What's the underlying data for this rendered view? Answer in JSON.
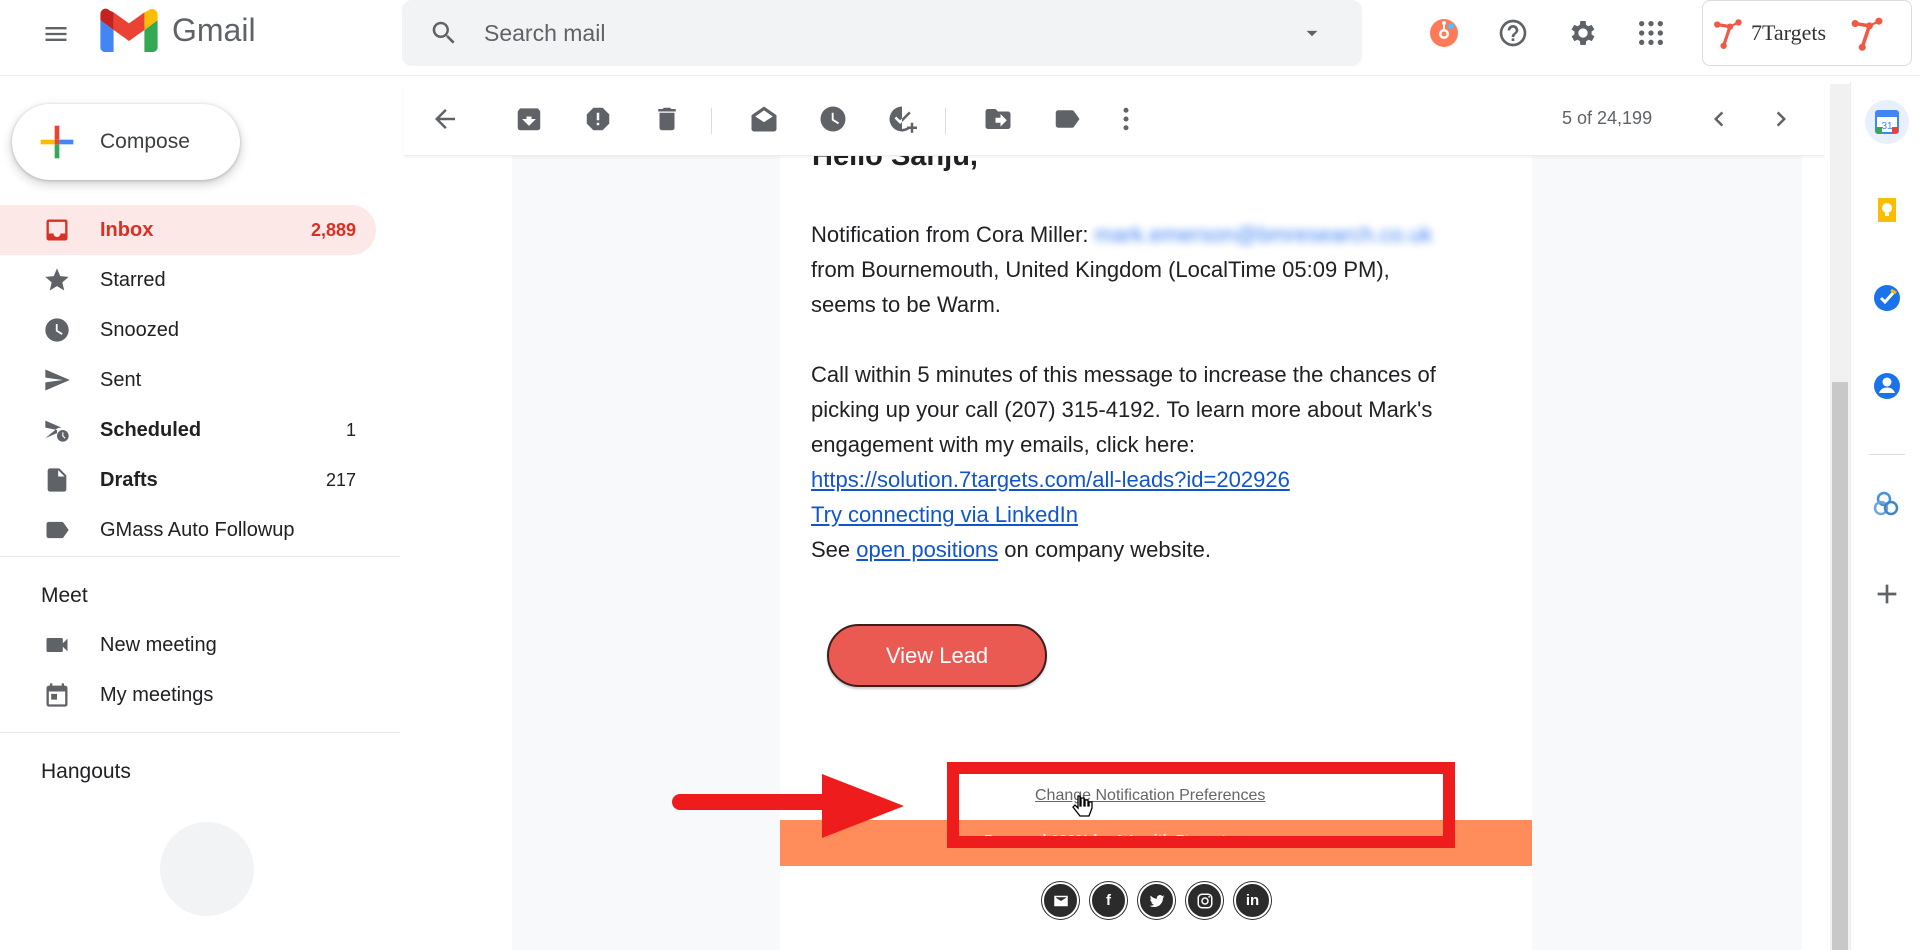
{
  "app": {
    "name": "Gmail"
  },
  "search": {
    "placeholder": "Search mail"
  },
  "header": {
    "brand_name": "7Targets"
  },
  "compose": {
    "label": "Compose"
  },
  "sidebar": {
    "items": [
      {
        "label": "Inbox",
        "count": "2,889"
      },
      {
        "label": "Starred",
        "count": ""
      },
      {
        "label": "Snoozed",
        "count": ""
      },
      {
        "label": "Sent",
        "count": ""
      },
      {
        "label": "Scheduled",
        "count": "1"
      },
      {
        "label": "Drafts",
        "count": "217"
      },
      {
        "label": "GMass Auto Followup",
        "count": ""
      }
    ],
    "meet_title": "Meet",
    "meet_items": [
      {
        "label": "New meeting"
      },
      {
        "label": "My meetings"
      }
    ],
    "hangouts_title": "Hangouts"
  },
  "toolbar": {
    "pager": "5 of 24,199"
  },
  "email": {
    "greeting": "Hello Sanju,",
    "line1_prefix": "Notification from Cora Miller:",
    "line1_email": "mark.emerson@bmresearch.co.uk",
    "line2": "from Bournemouth, United Kingdom (LocalTime 05:09 PM),",
    "line3": "seems to be Warm.",
    "para2_l1": "Call within 5 minutes of this message to increase the chances of",
    "para2_l2": "picking up your call (207) 315-4192. To learn more about Mark's",
    "para2_l3": "engagement with my emails, click here:",
    "lead_link": "https://solution.7targets.com/all-leads?id=202926",
    "linkedin_link": "Try connecting via LinkedIn",
    "see_prefix": "See",
    "positions_link": "open positions",
    "see_suffix": "on company website.",
    "view_lead_button": "View Lead",
    "pref_link": "Change Notification Preferences",
    "banner_text": "Powered 100% by A.I. with 7targets.com",
    "socials": [
      "email",
      "facebook",
      "twitter",
      "instagram",
      "linkedin"
    ]
  },
  "colors": {
    "gmail_red": "#d93025",
    "view_lead": "#ea5a52",
    "banner": "#ff8c5a",
    "annotation": "#ee1c1c",
    "link": "#1155cc"
  }
}
